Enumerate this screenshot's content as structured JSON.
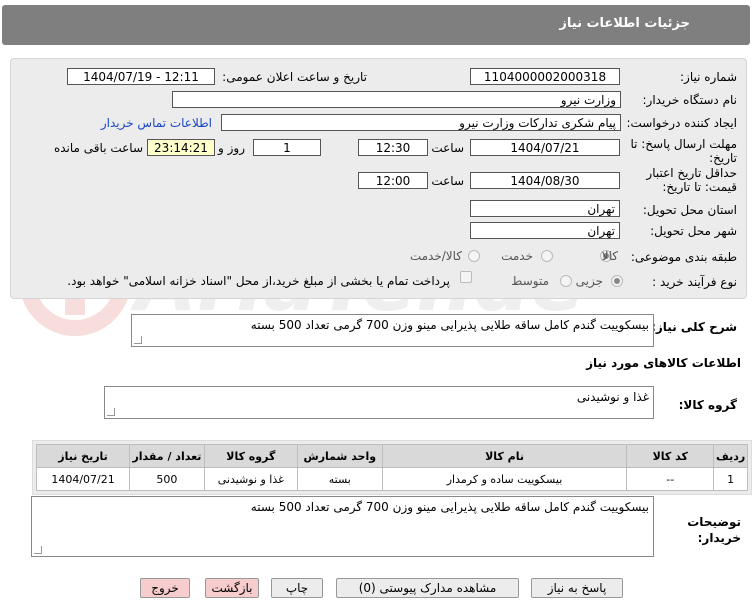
{
  "header": {
    "title": "جزئیات اطلاعات نیاز"
  },
  "fields": {
    "need_number_label": "شماره نیاز:",
    "need_number": "1104000002000318",
    "announce_label": "تاریخ و ساعت اعلان عمومی:",
    "announce_value": "1404/07/19 - 12:11",
    "buyer_org_label": "نام دستگاه خریدار:",
    "buyer_org": "وزارت نیرو",
    "creator_label": "ایجاد کننده درخواست:",
    "creator": "پیام شکری تداركات وزارت نیرو",
    "contact_link": "اطلاعات تماس خریدار",
    "deadline_label": "مهلت ارسال پاسخ: تا تاریخ:",
    "deadline_date": "1404/07/21",
    "time_label": "ساعت",
    "deadline_time": "12:30",
    "days_value": "1",
    "days_label": "روز و",
    "remaining_time": "23:14:21",
    "remaining_label": "ساعت باقی مانده",
    "validity_label": "حداقل تاریخ اعتبار قیمت: تا تاریخ:",
    "validity_date": "1404/08/30",
    "validity_time_label": "ساعت",
    "validity_time": "12:00",
    "province_label": "استان محل تحویل:",
    "province": "تهران",
    "city_label": "شهر محل تحویل:",
    "city": "تهران",
    "category_label": "طبقه بندی موضوعی:",
    "category_options": [
      "کالا",
      "خدمت",
      "کالا/خدمت"
    ],
    "process_label": "نوع فرآیند خرید :",
    "process_options": [
      "جزیی",
      "متوسط"
    ],
    "payment_text": "پرداخت تمام یا بخشی از مبلغ خرید،از محل \"اسناد خزانه اسلامی\" خواهد بود."
  },
  "description": {
    "label": "شرح کلی نیاز:",
    "text": "بیسکوییت گندم کامل ساقه طلایی پذیرایی مینو وزن 700 گرمی تعداد 500 بسته"
  },
  "goods_section": {
    "title": "اطلاعات کالاهای مورد نیاز",
    "group_label": "گروه کالا:",
    "group_value": "غذا و نوشیدنی"
  },
  "table": {
    "headers": [
      "ردیف",
      "کد کالا",
      "نام کالا",
      "واحد شمارش",
      "گروه کالا",
      "تعداد / مقدار",
      "تاریخ نیاز"
    ],
    "rows": [
      [
        "1",
        "--",
        "بیسکوییت ساده و کرمدار",
        "بسته",
        "غذا و نوشیدنی",
        "500",
        "1404/07/21"
      ]
    ]
  },
  "buyer_notes": {
    "label": "توضیحات خریدار:",
    "text": "بیسکوییت گندم کامل ساقه طلایی پذیرایی مینو وزن 700 گرمی تعداد 500 بسته"
  },
  "buttons": {
    "reply": "پاسخ به نیاز",
    "attachments": "مشاهده مدارک پیوستی (0)",
    "print": "چاپ",
    "back": "بازگشت",
    "exit": "خروج"
  },
  "watermark_text": "AriaTender.neT",
  "colors": {
    "header_bg": "#7f7f7f",
    "panel_bg": "#ececec",
    "link": "#1a47c6",
    "remaining_bg": "#ffffcc",
    "danger_btn": "#f6cccc"
  }
}
